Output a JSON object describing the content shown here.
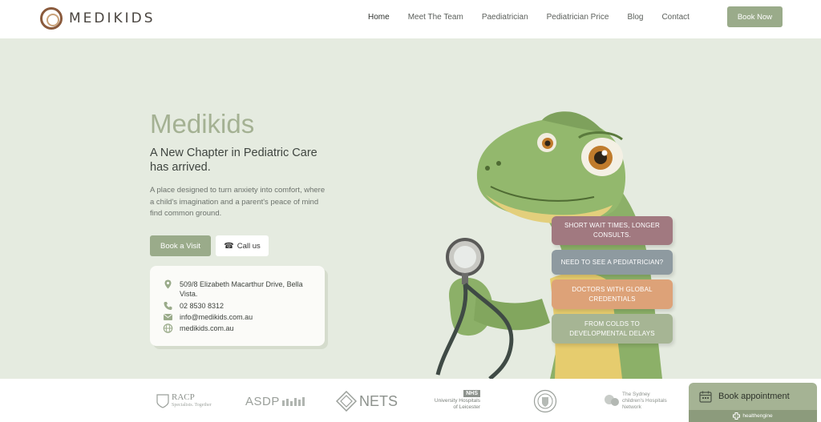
{
  "header": {
    "brand": "MEDIKIDS",
    "nav": [
      {
        "label": "Home"
      },
      {
        "label": "Meet The Team"
      },
      {
        "label": "Paediatrician"
      },
      {
        "label": "Pediatrician Price"
      },
      {
        "label": "Blog"
      },
      {
        "label": "Contact"
      }
    ],
    "book_now_label": "Book Now"
  },
  "hero": {
    "title": "Medikids",
    "subtitle": "A New Chapter in Pediatric Care has arrived.",
    "description": "A place designed to turn anxiety into comfort, where a child's imagination and a parent's peace of mind find common ground.",
    "book_visit_label": "Book a Visit",
    "call_label": "Call us"
  },
  "contact": {
    "address": "509/8 Elizabeth Macarthur Drive, Bella Vista.",
    "phone": "02 8530 8312",
    "email": "info@medikids.com.au",
    "website": "medikids.com.au"
  },
  "features": [
    {
      "label": "SHORT WAIT TIMES, LONGER CONSULTS."
    },
    {
      "label": "NEED TO SEE A PEDIATRICIAN?"
    },
    {
      "label": "DOCTORS WITH GLOBAL CREDENTIALS"
    },
    {
      "label": "FROM COLDS TO DEVELOPMENTAL DELAYS"
    }
  ],
  "partners": {
    "racp": "RACP",
    "racp_tag": "Specialists. Together",
    "asdp": "ASDP",
    "nets": "NETS",
    "nhs_badge": "NHS",
    "leicester": "University Hospitals of Leicester",
    "sydney": "The Sydney children's Hospitals Network"
  },
  "widget": {
    "label": "Book appointment",
    "powered_by": "healthengine"
  },
  "colors": {
    "accent": "#9aab8a",
    "title": "#a4b193",
    "background": "#e5ebe0",
    "pill_mauve": "#a17980",
    "pill_slate": "#8e9aa0",
    "pill_orange": "#dda278",
    "pill_green": "#a6b594"
  }
}
